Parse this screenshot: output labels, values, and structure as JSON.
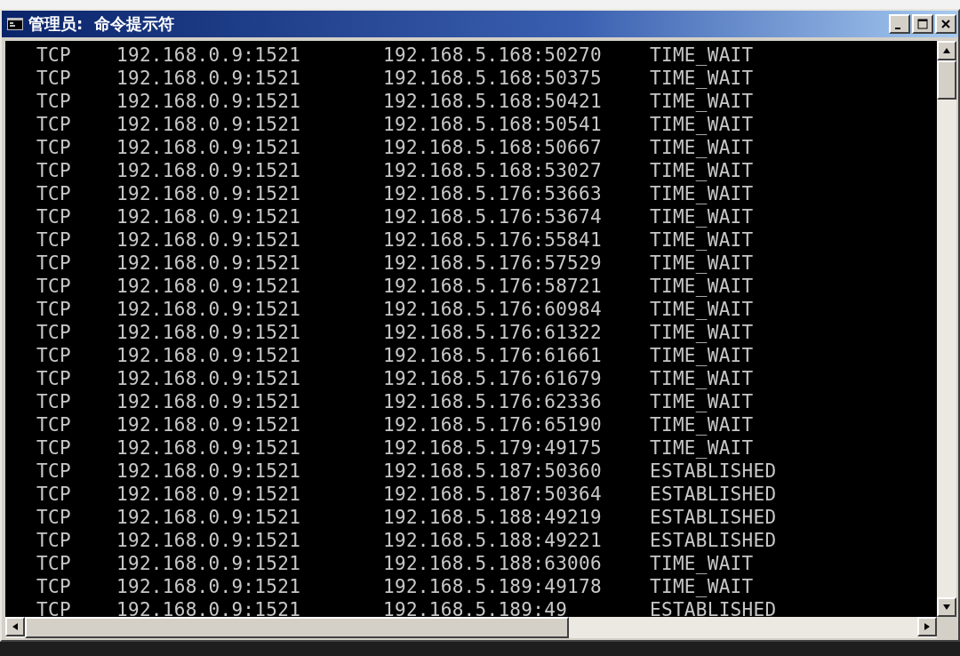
{
  "window": {
    "title": "管理员:  命令提示符"
  },
  "rows": [
    {
      "proto": "TCP",
      "local": "192.168.0.9:1521",
      "foreign": "192.168.5.168:50270",
      "state": "TIME_WAIT"
    },
    {
      "proto": "TCP",
      "local": "192.168.0.9:1521",
      "foreign": "192.168.5.168:50375",
      "state": "TIME_WAIT"
    },
    {
      "proto": "TCP",
      "local": "192.168.0.9:1521",
      "foreign": "192.168.5.168:50421",
      "state": "TIME_WAIT"
    },
    {
      "proto": "TCP",
      "local": "192.168.0.9:1521",
      "foreign": "192.168.5.168:50541",
      "state": "TIME_WAIT"
    },
    {
      "proto": "TCP",
      "local": "192.168.0.9:1521",
      "foreign": "192.168.5.168:50667",
      "state": "TIME_WAIT"
    },
    {
      "proto": "TCP",
      "local": "192.168.0.9:1521",
      "foreign": "192.168.5.168:53027",
      "state": "TIME_WAIT"
    },
    {
      "proto": "TCP",
      "local": "192.168.0.9:1521",
      "foreign": "192.168.5.176:53663",
      "state": "TIME_WAIT"
    },
    {
      "proto": "TCP",
      "local": "192.168.0.9:1521",
      "foreign": "192.168.5.176:53674",
      "state": "TIME_WAIT"
    },
    {
      "proto": "TCP",
      "local": "192.168.0.9:1521",
      "foreign": "192.168.5.176:55841",
      "state": "TIME_WAIT"
    },
    {
      "proto": "TCP",
      "local": "192.168.0.9:1521",
      "foreign": "192.168.5.176:57529",
      "state": "TIME_WAIT"
    },
    {
      "proto": "TCP",
      "local": "192.168.0.9:1521",
      "foreign": "192.168.5.176:58721",
      "state": "TIME_WAIT"
    },
    {
      "proto": "TCP",
      "local": "192.168.0.9:1521",
      "foreign": "192.168.5.176:60984",
      "state": "TIME_WAIT"
    },
    {
      "proto": "TCP",
      "local": "192.168.0.9:1521",
      "foreign": "192.168.5.176:61322",
      "state": "TIME_WAIT"
    },
    {
      "proto": "TCP",
      "local": "192.168.0.9:1521",
      "foreign": "192.168.5.176:61661",
      "state": "TIME_WAIT"
    },
    {
      "proto": "TCP",
      "local": "192.168.0.9:1521",
      "foreign": "192.168.5.176:61679",
      "state": "TIME_WAIT"
    },
    {
      "proto": "TCP",
      "local": "192.168.0.9:1521",
      "foreign": "192.168.5.176:62336",
      "state": "TIME_WAIT"
    },
    {
      "proto": "TCP",
      "local": "192.168.0.9:1521",
      "foreign": "192.168.5.176:65190",
      "state": "TIME_WAIT"
    },
    {
      "proto": "TCP",
      "local": "192.168.0.9:1521",
      "foreign": "192.168.5.179:49175",
      "state": "TIME_WAIT"
    },
    {
      "proto": "TCP",
      "local": "192.168.0.9:1521",
      "foreign": "192.168.5.187:50360",
      "state": "ESTABLISHED"
    },
    {
      "proto": "TCP",
      "local": "192.168.0.9:1521",
      "foreign": "192.168.5.187:50364",
      "state": "ESTABLISHED"
    },
    {
      "proto": "TCP",
      "local": "192.168.0.9:1521",
      "foreign": "192.168.5.188:49219",
      "state": "ESTABLISHED"
    },
    {
      "proto": "TCP",
      "local": "192.168.0.9:1521",
      "foreign": "192.168.5.188:49221",
      "state": "ESTABLISHED"
    },
    {
      "proto": "TCP",
      "local": "192.168.0.9:1521",
      "foreign": "192.168.5.188:63006",
      "state": "TIME_WAIT"
    },
    {
      "proto": "TCP",
      "local": "192.168.0.9:1521",
      "foreign": "192.168.5.189:49178",
      "state": "TIME_WAIT"
    },
    {
      "proto": "TCP",
      "local": "192.168.0.9:1521",
      "foreign": "192.168.5.189:49",
      "state": "ESTABLISHED"
    }
  ]
}
